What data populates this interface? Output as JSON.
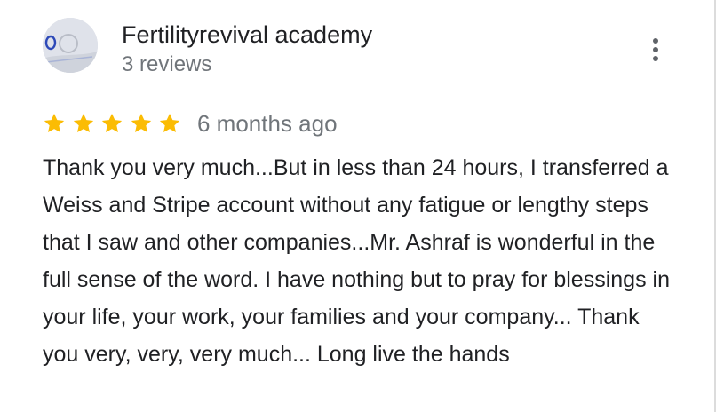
{
  "reviewer": {
    "name": "Fertilityrevival academy",
    "review_count": "3 reviews",
    "avatar_icon": "profile-photo"
  },
  "menu": {
    "icon": "more-vert-icon"
  },
  "review": {
    "rating": 5,
    "rating_max": 5,
    "star_color": "#fbbc04",
    "date": "6 months ago",
    "text": "Thank you very much...But in less than 24 hours, I transferred a Weiss and Stripe account without any fatigue or lengthy steps that I saw and other companies...Mr. Ashraf is wonderful in the full sense of the word. I have nothing but to pray for blessings in your life, your work, your families and your company... Thank you very, very, very much... Long live the hands"
  }
}
